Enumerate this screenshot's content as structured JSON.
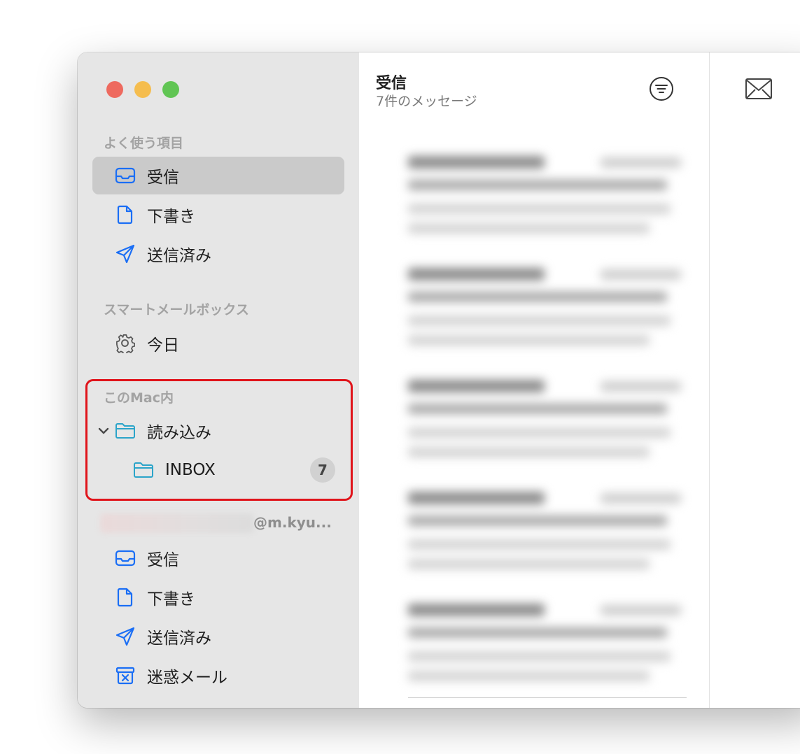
{
  "colors": {
    "accent": "#1a6ef5",
    "folder": "#2ba4c9",
    "highlight": "#e0141b"
  },
  "window_controls": [
    "close",
    "minimize",
    "zoom"
  ],
  "sidebar": {
    "favorites_header": "よく使う項目",
    "favorites": [
      {
        "label": "受信",
        "icon": "inbox-tray-icon",
        "selected": true
      },
      {
        "label": "下書き",
        "icon": "document-icon"
      },
      {
        "label": "送信済み",
        "icon": "paper-plane-icon"
      }
    ],
    "smart_header": "スマートメールボックス",
    "smart": [
      {
        "label": "今日",
        "icon": "gear-icon"
      }
    ],
    "onmac_header": "このMac内",
    "onmac_folder": "読み込み",
    "onmac_subfolder": "INBOX",
    "onmac_badge": "7",
    "account_suffix": "@m.kyu...",
    "account": [
      {
        "label": "受信",
        "icon": "inbox-tray-icon"
      },
      {
        "label": "下書き",
        "icon": "document-icon"
      },
      {
        "label": "送信済み",
        "icon": "paper-plane-icon"
      },
      {
        "label": "迷惑メール",
        "icon": "junk-bin-icon"
      }
    ]
  },
  "message_list": {
    "title": "受信",
    "subtitle": "7件のメッセージ",
    "filter_icon": "filter-icon"
  },
  "viewer": {
    "icon": "envelope-icon"
  }
}
